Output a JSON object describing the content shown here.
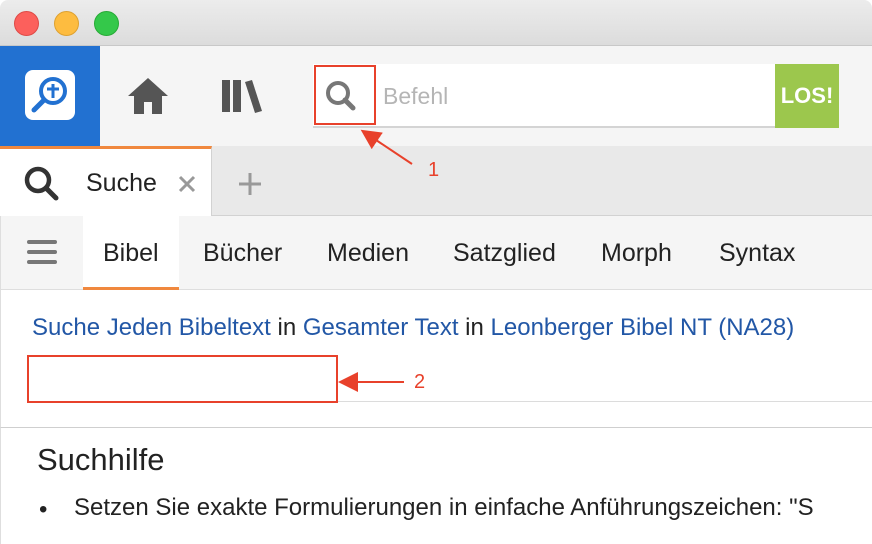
{
  "toolbar": {
    "command_placeholder": "Befehl",
    "go_label": "LOS!",
    "icons": {
      "logo": "magnifier-cross-logo-icon",
      "home": "home-icon",
      "library": "library-books-icon",
      "command_search": "search-icon"
    },
    "colors": {
      "logo_bg": "#2271d1",
      "go_bg": "#9cc74d"
    }
  },
  "tabs": {
    "active_label": "Suche",
    "close_glyph": "×",
    "new_tab_glyph": "+",
    "accent_color": "#f0883e"
  },
  "submenu": {
    "items": [
      "Bibel",
      "Bücher",
      "Medien",
      "Satzglied",
      "Morph",
      "Syntax"
    ],
    "active": "Bibel"
  },
  "query": {
    "suche": "Suche",
    "scope": "Jeden Bibeltext",
    "in1": "in",
    "range": "Gesamter Text",
    "in2": "in",
    "bible": "Leonberger Bibel NT (NA28)",
    "input_value": ""
  },
  "help": {
    "title": "Suchhilfe",
    "bullet": "•",
    "line1": "Setzen Sie exakte Formulierungen in einfache Anführungszeichen: \"S"
  },
  "annotations": {
    "label1": "1",
    "label2": "2",
    "color": "#e8412b"
  }
}
